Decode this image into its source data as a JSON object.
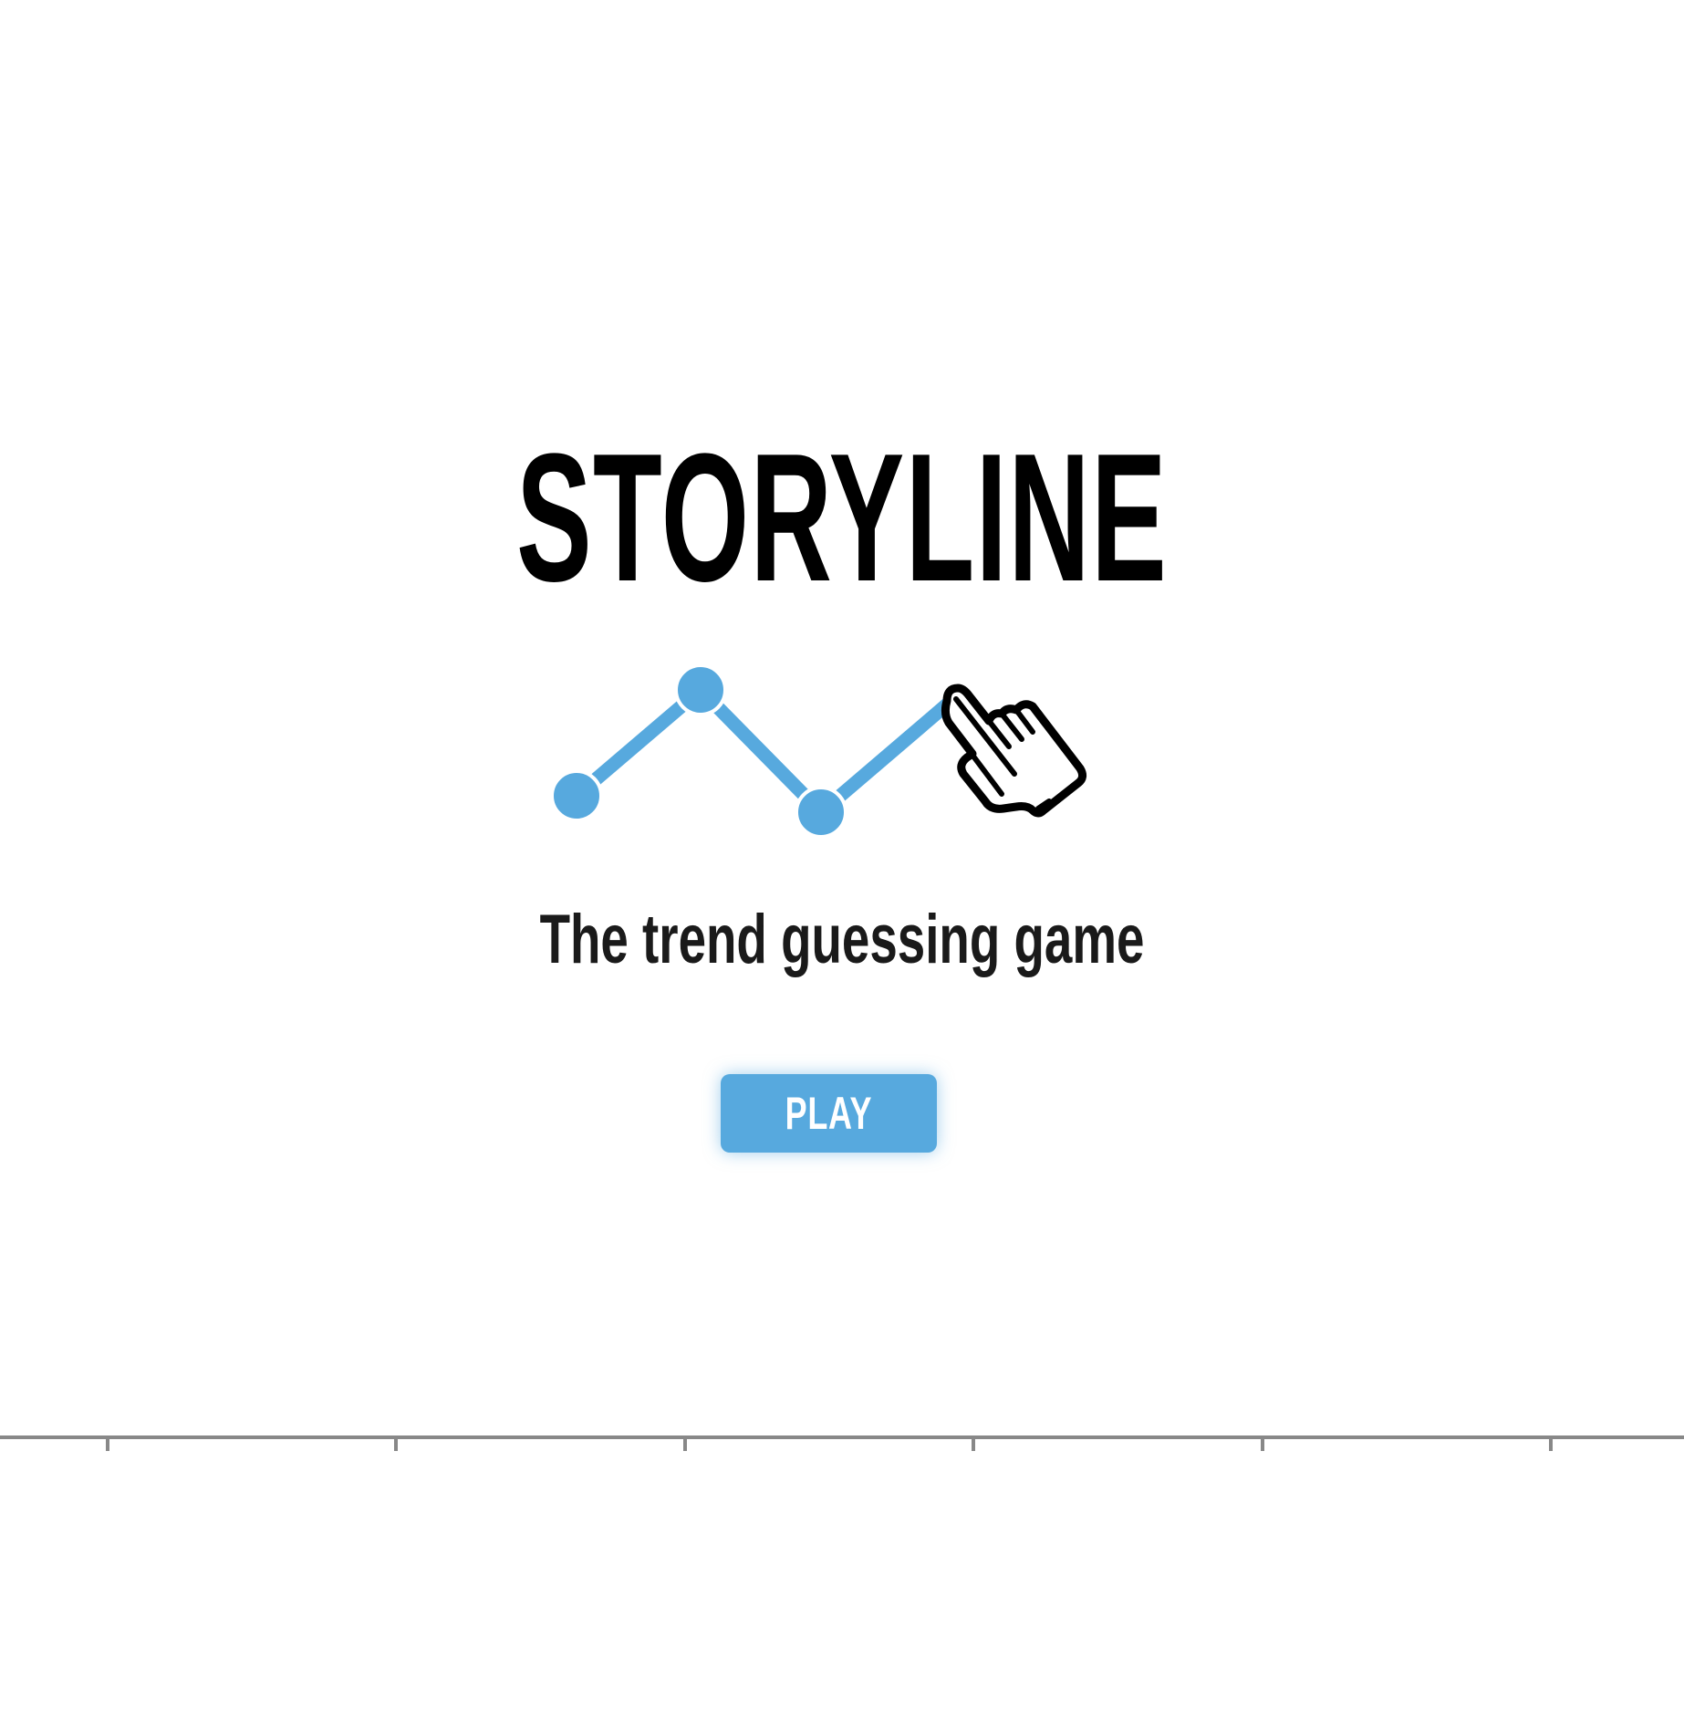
{
  "title": "STORYLINE",
  "subtitle": "The trend guessing game",
  "play_button": {
    "label": "PLAY"
  },
  "logo": {
    "line_color": "#57a9de",
    "hand_icon": "pointing-hand-icon"
  },
  "colors": {
    "accent": "#57a9de",
    "text": "#000000",
    "axis": "#888888"
  }
}
